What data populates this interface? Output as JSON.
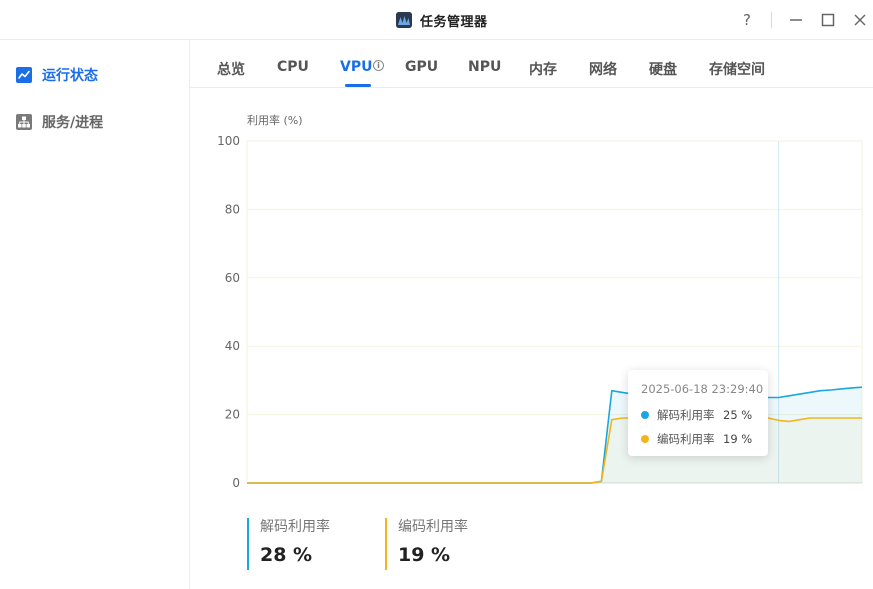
{
  "window": {
    "title": "任务管理器",
    "help_label": "?"
  },
  "sidebar": {
    "items": [
      {
        "label": "运行状态",
        "icon": "line-chart-icon",
        "active": true
      },
      {
        "label": "服务/进程",
        "icon": "hierarchy-icon",
        "active": false
      }
    ]
  },
  "tabs": [
    {
      "label": "总览"
    },
    {
      "label": "CPU"
    },
    {
      "label": "VPU",
      "active": true,
      "info": "ⓘ"
    },
    {
      "label": "GPU"
    },
    {
      "label": "NPU"
    },
    {
      "label": "内存"
    },
    {
      "label": "网络"
    },
    {
      "label": "硬盘"
    },
    {
      "label": "存储空间"
    }
  ],
  "colors": {
    "accent": "#1a6ee8",
    "decode": "#1aa7de",
    "encode": "#f2b51d"
  },
  "chart_data": {
    "type": "line",
    "ylabel": "利用率 (%)",
    "ylim": [
      0,
      100
    ],
    "yticks": [
      "100",
      "80",
      "60",
      "40",
      "20",
      "0"
    ],
    "x": [
      0,
      1,
      2,
      3,
      4,
      5,
      6,
      7,
      8,
      9,
      10,
      11,
      12,
      13,
      14,
      15,
      16,
      17,
      18,
      19,
      20,
      21,
      22,
      23,
      24,
      25,
      26,
      27,
      28,
      29,
      30,
      31,
      32,
      33,
      34,
      35,
      36,
      37,
      38,
      39,
      40,
      41,
      42,
      43,
      44,
      45,
      46,
      47,
      48,
      49,
      50,
      51,
      52,
      53,
      54,
      55,
      56,
      57,
      58,
      59
    ],
    "series": [
      {
        "name": "解码利用率",
        "color": "#1aa7de",
        "values": [
          0,
          0,
          0,
          0,
          0,
          0,
          0,
          0,
          0,
          0,
          0,
          0,
          0,
          0,
          0,
          0,
          0,
          0,
          0,
          0,
          0,
          0,
          0,
          0,
          0,
          0,
          0,
          0,
          0,
          0,
          0,
          0,
          0,
          0,
          0.5,
          27,
          26.5,
          26,
          25.8,
          25.5,
          25.3,
          25.2,
          25,
          25,
          25,
          25,
          25,
          25,
          25,
          25,
          25,
          25,
          25.5,
          26,
          26.5,
          27,
          27.2,
          27.5,
          27.8,
          28
        ]
      },
      {
        "name": "编码利用率",
        "color": "#f2b51d",
        "values": [
          0,
          0,
          0,
          0,
          0,
          0,
          0,
          0,
          0,
          0,
          0,
          0,
          0,
          0,
          0,
          0,
          0,
          0,
          0,
          0,
          0,
          0,
          0,
          0,
          0,
          0,
          0,
          0,
          0,
          0,
          0,
          0,
          0,
          0,
          0.5,
          18.5,
          19,
          19,
          19,
          19,
          19,
          19,
          19,
          19,
          19,
          19,
          19,
          19,
          19,
          19,
          19,
          18.3,
          18,
          18.5,
          19,
          19,
          19,
          19,
          19,
          19
        ]
      }
    ],
    "hover_index": 51,
    "tooltip": {
      "time": "2025-06-18 23:29:40",
      "rows": [
        {
          "name": "解码利用率",
          "value": "25 %"
        },
        {
          "name": "编码利用率",
          "value": "19 %"
        }
      ]
    }
  },
  "summary": [
    {
      "label": "解码利用率",
      "value": "28 %",
      "color": "#1aa7de"
    },
    {
      "label": "编码利用率",
      "value": "19 %",
      "color": "#f2b51d"
    }
  ]
}
